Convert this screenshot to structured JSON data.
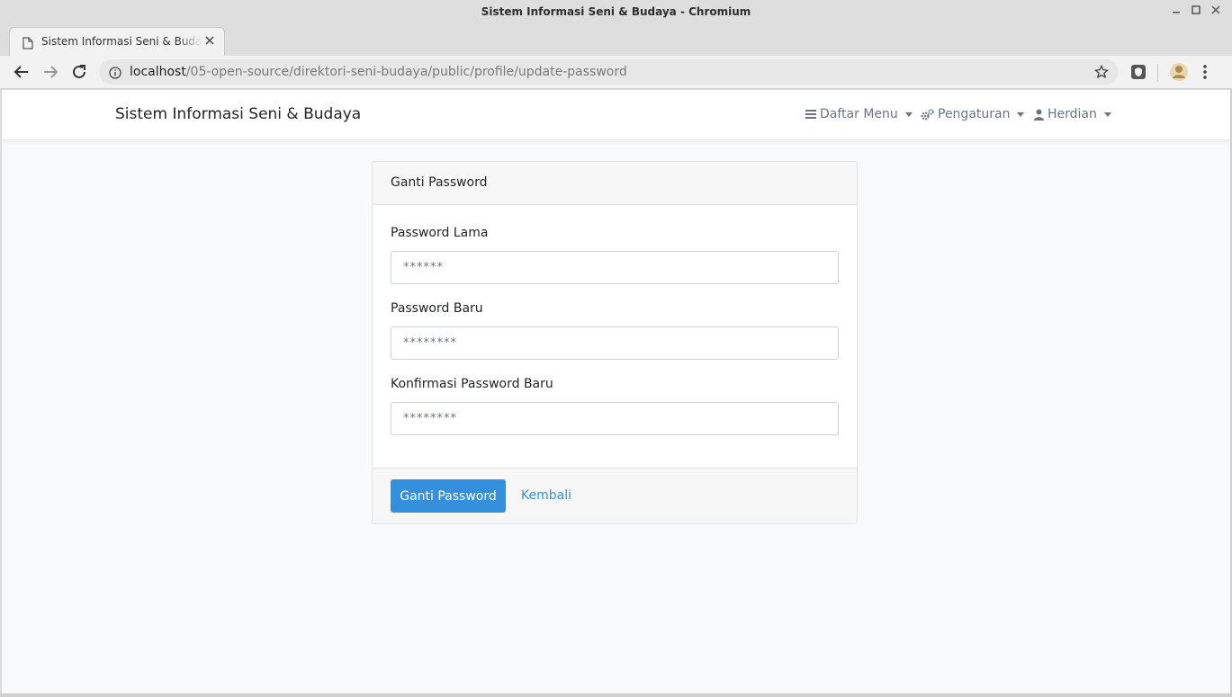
{
  "window": {
    "title": "Sistem Informasi Seni & Budaya - Chromium"
  },
  "tab": {
    "title": "Sistem Informasi Seni & Budaya - Chromium",
    "icon": "document-icon"
  },
  "address_bar": {
    "host": "localhost",
    "path": "/05-open-source/direktori-seni-budaya/public/profile/update-password"
  },
  "navbar": {
    "brand": "Sistem Informasi Seni & Budaya",
    "items": [
      {
        "label": "Daftar Menu",
        "icon": "bars-icon"
      },
      {
        "label": "Pengaturan",
        "icon": "cogs-icon"
      },
      {
        "label": "Herdian",
        "icon": "user-icon"
      }
    ]
  },
  "form": {
    "header": "Ganti Password",
    "fields": [
      {
        "label": "Password Lama",
        "placeholder": "******"
      },
      {
        "label": "Password Baru",
        "placeholder": "********"
      },
      {
        "label": "Konfirmasi Password Baru",
        "placeholder": "********"
      }
    ],
    "submit_label": "Ganti Password",
    "back_label": "Kembali"
  },
  "colors": {
    "primary": "#3490dc",
    "page_background": "#f8f9fa",
    "nav_text": "#6c757d"
  }
}
